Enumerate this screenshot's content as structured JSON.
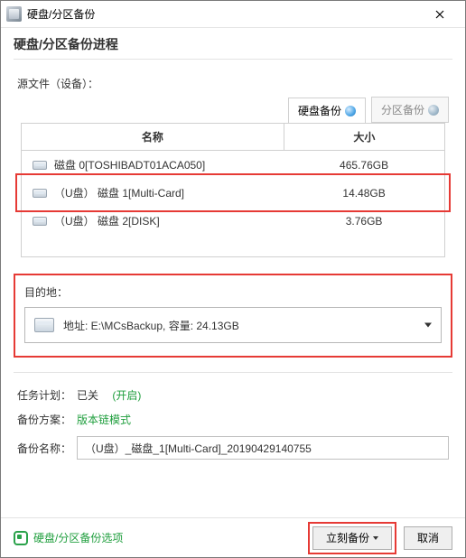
{
  "window": {
    "title": "硬盘/分区备份"
  },
  "section": {
    "header": "硬盘/分区备份进程",
    "source_label": "源文件（设备）："
  },
  "tabs": {
    "disk_backup": "硬盘备份",
    "part_backup": "分区备份"
  },
  "grid": {
    "col_name": "名称",
    "col_size": "大小",
    "rows": [
      {
        "name": "磁盘 0[TOSHIBADT01ACA050]",
        "size": "465.76GB"
      },
      {
        "name": "（U盘） 磁盘 1[Multi-Card]",
        "size": "14.48GB"
      },
      {
        "name": "（U盘） 磁盘 2[DISK]",
        "size": "3.76GB"
      }
    ]
  },
  "dest": {
    "label": "目的地：",
    "value": "地址: E:\\MCsBackup, 容量: 24.13GB"
  },
  "schedule": {
    "label": "任务计划：",
    "status": "已关",
    "toggle": "(开启)"
  },
  "scheme": {
    "label": "备份方案：",
    "value": "版本链模式"
  },
  "backup_name": {
    "label": "备份名称：",
    "value": "（U盘）_磁盘_1[Multi-Card]_20190429140755"
  },
  "footer": {
    "options": "硬盘/分区备份选项",
    "primary": "立刻备份",
    "cancel": "取消"
  }
}
